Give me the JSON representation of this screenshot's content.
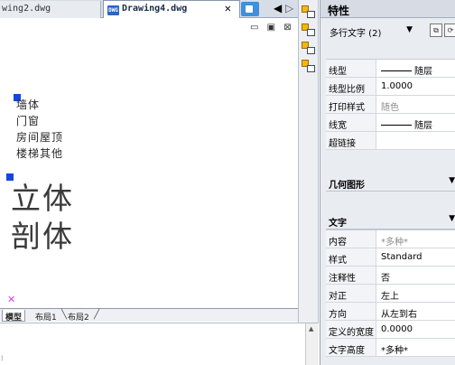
{
  "tabs": {
    "previous_tab": "wing2.dwg",
    "active_tab": "Drawing4.dwg",
    "file_badge": "DWG",
    "close_glyph": "✕"
  },
  "canvas": {
    "window_controls": "▭ ▣ ⊠",
    "small_lines": [
      "墙体",
      "门窗",
      "房间屋顶",
      "楼梯其他"
    ],
    "big_lines": [
      "立体",
      "剖体"
    ],
    "ucs_mark": "✕"
  },
  "layout_tabs": [
    "模型",
    "布局1",
    "布局2"
  ],
  "properties": {
    "title": "特性",
    "selection": "多行文字 (2)",
    "general_rows": [
      {
        "label": "线型",
        "value": "随层",
        "line": true
      },
      {
        "label": "线型比例",
        "value": "1.0000"
      },
      {
        "label": "打印样式",
        "value": "随色",
        "dim": true
      },
      {
        "label": "线宽",
        "value": "随层",
        "line": true
      },
      {
        "label": "超链接",
        "value": ""
      }
    ],
    "geometry_header": "几何图形",
    "text_header": "文字",
    "text_rows": [
      {
        "label": "内容",
        "value": "*多种*",
        "dim": true
      },
      {
        "label": "样式",
        "value": "Standard"
      },
      {
        "label": "注释性",
        "value": "否"
      },
      {
        "label": "对正",
        "value": "左上"
      },
      {
        "label": "方向",
        "value": "从左到右"
      },
      {
        "label": "定义的宽度",
        "value": "0.0000"
      },
      {
        "label": "文字高度",
        "value": "*多种*"
      }
    ]
  },
  "colors": {
    "grip_blue": "#1446e0",
    "toolbar_icon_yellow": "#f4b70e",
    "ucs_magenta": "#e040e0"
  }
}
